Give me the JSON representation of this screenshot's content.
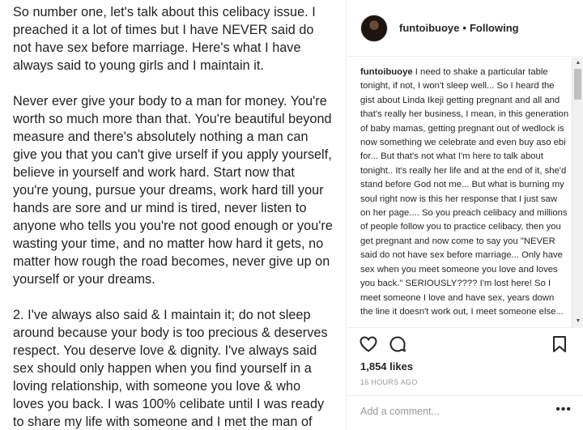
{
  "post_image": {
    "paragraphs": [
      "So number one, let's talk about this celibacy issue. I preached it a lot of times but I have NEVER said do not have sex before marriage. Here's what I have always said to young girls and I maintain it.",
      "Never ever give your body to a man for money. You're worth so much more than that. You're beautiful beyond measure and there's absolutely nothing a man can give you that you can't give urself if you apply yourself, believe in yourself and work hard. Start now that you're young, pursue your dreams, work hard till your hands are sore and ur mind is tired, never listen to anyone who tells you you're not good enough or you're wasting your time, and no matter how hard it gets, no matter how rough the road becomes, never give up on yourself or your dreams.",
      "2. I've always also said & I maintain it; do not sleep around because your body is too precious & deserves respect. You deserve love & dignity. I've always said sex should only happen when you find yourself in a loving relationship, with someone you love & who loves you back. I was 100% celibate until I was ready to share my life with someone and I met the man of"
    ]
  },
  "header": {
    "username": "funtoibuoye",
    "separator": "•",
    "follow_status": "Following"
  },
  "caption": {
    "username": "funtoibuoye",
    "text": "I need to shake a particular table tonight, if not, I won't sleep well... So I heard the gist about Linda Ikeji getting pregnant and all and that's really her business, I mean, in this generation of baby mamas, getting pregnant out of wedlock is now something we celebrate and even buy aso ebi for... But that's not what I'm here to talk about tonight.. It's really her life and at the end of it, she'd stand before God not me... But what is burning my soul right now is this her response that I just saw on her page.... So you preach celibacy and millions of people follow you to practice celibacy, then you get pregnant and now come to say you \"NEVER said do not have sex before marriage... Only have sex when you meet someone you love and loves you back.\" SERIOUSLY???? I'm lost here! So I meet someone I love and have sex, years down the line it doesn't work out, I meet someone else..."
  },
  "actions": {
    "like_icon": "heart-icon",
    "comment_icon": "comment-icon",
    "save_icon": "bookmark-icon",
    "likes": "1,854 likes",
    "timestamp": "16 HOURS AGO"
  },
  "add_comment": {
    "placeholder": "Add a comment...",
    "more_label": "•••"
  },
  "colors": {
    "text": "#262626",
    "muted": "#999999",
    "border": "#efefef"
  }
}
